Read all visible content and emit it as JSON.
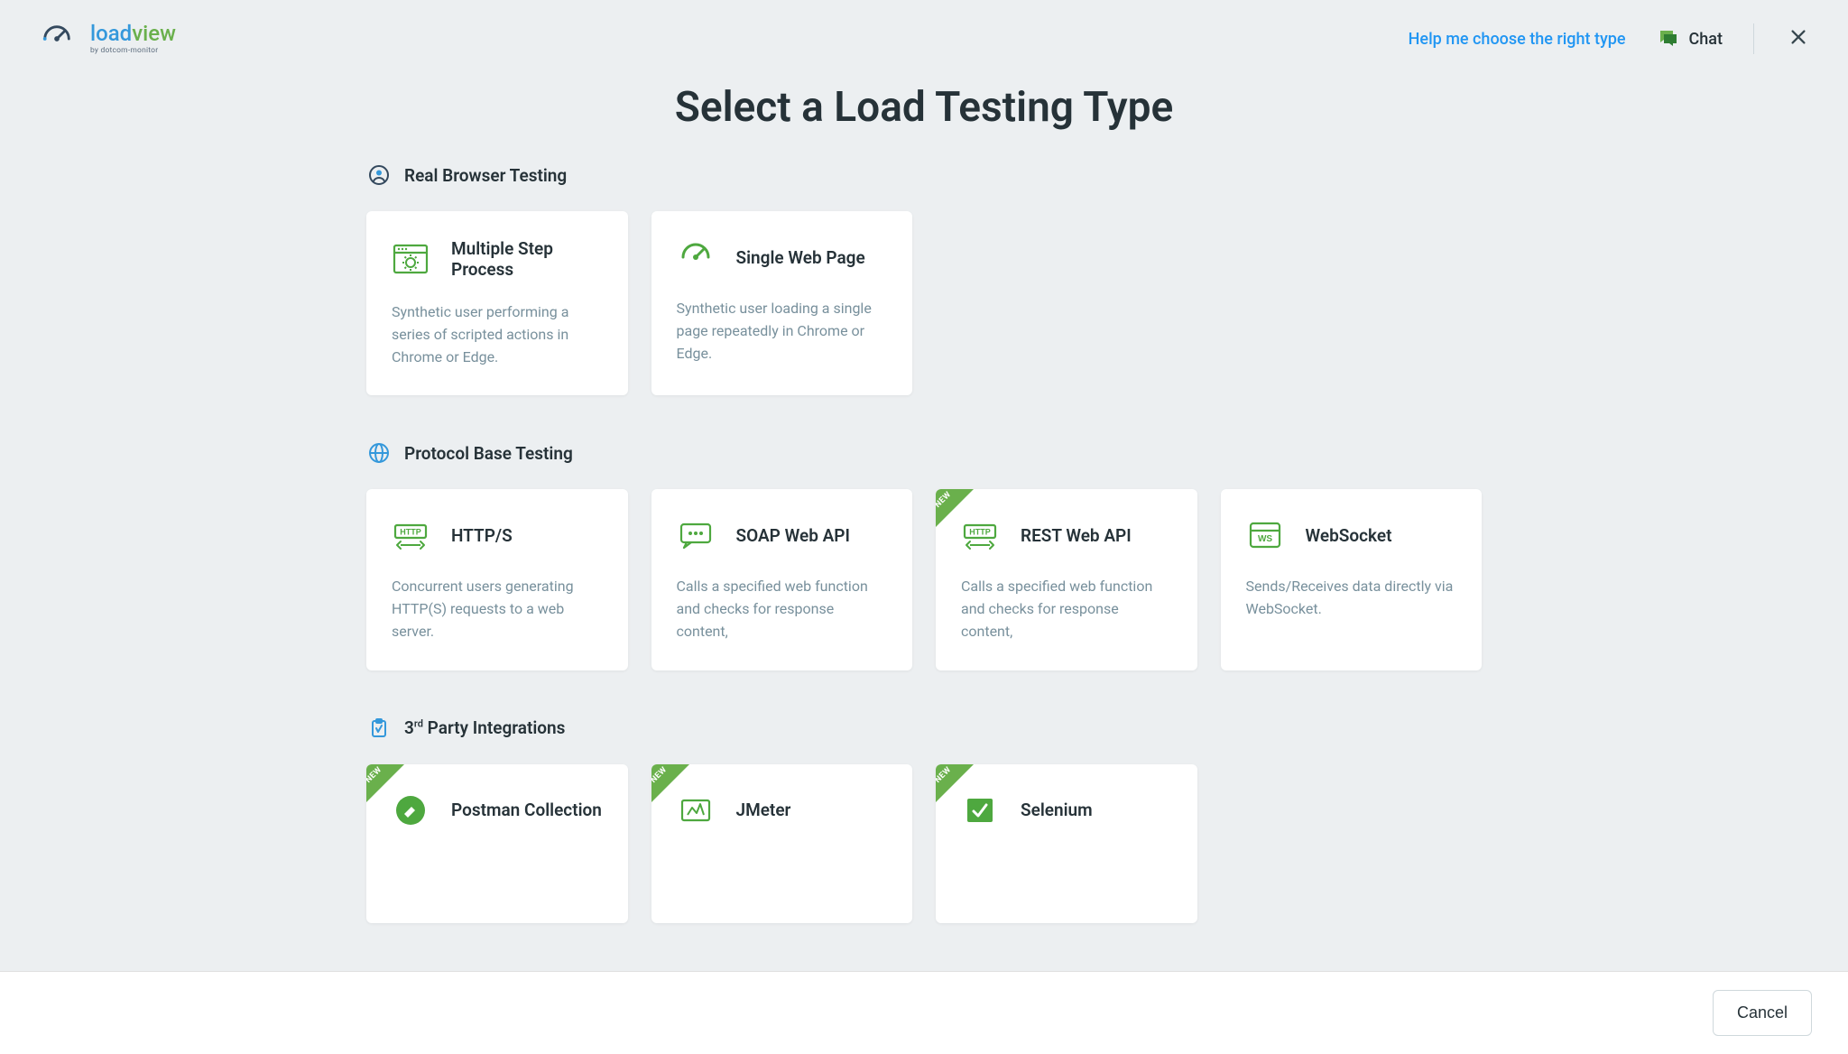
{
  "header": {
    "logo_main_load": "load",
    "logo_main_view": "view",
    "logo_sub": "by dotcom-monitor",
    "help_link": "Help me choose the right type",
    "chat_label": "Chat"
  },
  "page": {
    "title": "Select a Load Testing Type"
  },
  "sections": [
    {
      "title": "Real Browser Testing",
      "icon": "user-circle",
      "cards": [
        {
          "icon": "browser-gear",
          "title": "Multiple Step Process",
          "desc": "Synthetic user performing a series of scripted actions in Chrome or Edge.",
          "new": false
        },
        {
          "icon": "gauge",
          "title": "Single Web Page",
          "desc": "Synthetic user loading a single page repeatedly in Chrome or Edge.",
          "new": false
        }
      ]
    },
    {
      "title": "Protocol Base Testing",
      "icon": "globe",
      "cards": [
        {
          "icon": "http",
          "title": "HTTP/S",
          "desc": "Concurrent users generating HTTP(S) requests to a web server.",
          "new": false
        },
        {
          "icon": "soap",
          "title": "SOAP Web API",
          "desc": "Calls a specified web function and checks for response content,",
          "new": false
        },
        {
          "icon": "http",
          "title": "REST Web API",
          "desc": "Calls a specified web function and checks for response content,",
          "new": true
        },
        {
          "icon": "ws",
          "title": "WebSocket",
          "desc": "Sends/Receives data directly via WebSocket.",
          "new": false
        }
      ]
    },
    {
      "title_html": "3<sup>rd</sup> Party Integrations",
      "title": "3rd Party Integrations",
      "icon": "clipboard",
      "cards": [
        {
          "icon": "postman",
          "title": "Postman Collection",
          "desc": "",
          "new": true
        },
        {
          "icon": "jmeter",
          "title": "JMeter",
          "desc": "",
          "new": true
        },
        {
          "icon": "selenium",
          "title": "Selenium",
          "desc": "",
          "new": true
        }
      ]
    }
  ],
  "footer": {
    "cancel_label": "Cancel"
  },
  "new_badge_text": "NEW"
}
